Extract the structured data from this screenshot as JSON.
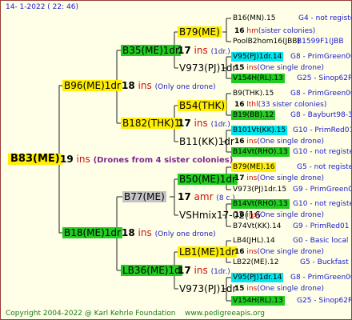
{
  "header": {
    "date": "14-  1-2022 ( 22: 46)"
  },
  "footer": {
    "copyright": "Copyright 2004-2022 @ Karl Kehrle Foundation",
    "site": "www.pedigreeapis.org"
  },
  "root": {
    "name": "B83(ME)",
    "num": "19",
    "ins": "ins",
    "note": "(Drones from 4 sister colonies)"
  },
  "father": {
    "name": "B96(ME)1dr",
    "num": "18",
    "ins": "ins",
    "note": "(Only one drone)"
  },
  "mother": {
    "name": "B18(ME)1dr",
    "num": "18",
    "ins": "ins",
    "note": "(Only one drone)"
  },
  "ff": {
    "name": "B35(ME)1dr",
    "num": "17",
    "ins": "ins",
    "note": "(1dr.)"
  },
  "fm": {
    "name": "B182(THK)1",
    "num": "17",
    "ins": "ins",
    "note": "(1dr.)"
  },
  "mf": {
    "name": "B77(ME)",
    "num": "17",
    "ins": "amr",
    "note": "(8 c.)"
  },
  "mm": {
    "name": "LB36(ME)1d",
    "num": "17",
    "ins": "ins",
    "note": "(1dr.)"
  },
  "g1": {
    "name": "B79(ME)",
    "num": "16",
    "ins": "hm",
    "note": "(sister colonies)"
  },
  "g2": {
    "name": "V973(PJ)1dr",
    "num": "15",
    "ins": "ins",
    "note": "(One single drone)"
  },
  "g3": {
    "name": "B54(THK)",
    "num": "16",
    "ins": "lthl",
    "note": "(33 sister colonies)"
  },
  "g4": {
    "name": "B11(KK)1dr",
    "num": "16",
    "ins": "ins",
    "note": "(One single drone)"
  },
  "g5": {
    "name": "B50(ME)1dr",
    "num": "17",
    "ins": "ins",
    "note": "(One single drone)"
  },
  "g6": {
    "name": "VSHmix17-02(16",
    "num": "16",
    "ins": "ins",
    "note": "(One single drone)"
  },
  "g7": {
    "name": "LB1(ME)1dr",
    "num": "16",
    "ins": "ins",
    "note": "(One single drone)"
  },
  "g8": {
    "name": "V973(PJ)1dr",
    "num": "15",
    "ins": "ins",
    "note": "(One single drone)"
  },
  "leaves": [
    {
      "name": "B16(MN).15",
      "gen": "G4 - not registe"
    },
    {
      "name": "PoolB2hom16(JBB)",
      "gen": "B1599F1(JBB"
    },
    {
      "name": "V95(PJ)1dr.14",
      "gen": "G8 - PrimGreen00"
    },
    {
      "name": "V154H(RL).13",
      "gen": "G25 - Sinop62R"
    },
    {
      "name": "B9(THK).15",
      "gen": "G8 - PrimGreen00"
    },
    {
      "name": "B19(BB).12",
      "gen": "G8 - Bayburt98-3"
    },
    {
      "name": "B101Vt(KK).15",
      "gen": "G10 - PrimRed01"
    },
    {
      "name": "B14Vt(RHO).13",
      "gen": "G10 - not registe"
    },
    {
      "name": "B79(ME).16",
      "gen": "G5 - not registe"
    },
    {
      "name": "V973(PJ)1dr.15",
      "gen": "G9 - PrimGreen00"
    },
    {
      "name": "B14Vt(RHO).13",
      "gen": "G10 - not registe"
    },
    {
      "name": "B74Vt(KK).14",
      "gen": "G9 - PrimRed01"
    },
    {
      "name": "LB4(JHL).14",
      "gen": "G0 - Basic local"
    },
    {
      "name": "LB22(ME).12",
      "gen": "G5 - Buckfast"
    },
    {
      "name": "V95(PJ)1dr.14",
      "gen": "G8 - PrimGreen00"
    },
    {
      "name": "V154H(RL).13",
      "gen": "G25 - Sinop62R"
    }
  ],
  "colors": {
    "yellow": "#ffee00",
    "green": "#22cc22",
    "cyan": "#00e5ee",
    "gray": "#c4c4c4",
    "border": "#9a3b3b"
  }
}
